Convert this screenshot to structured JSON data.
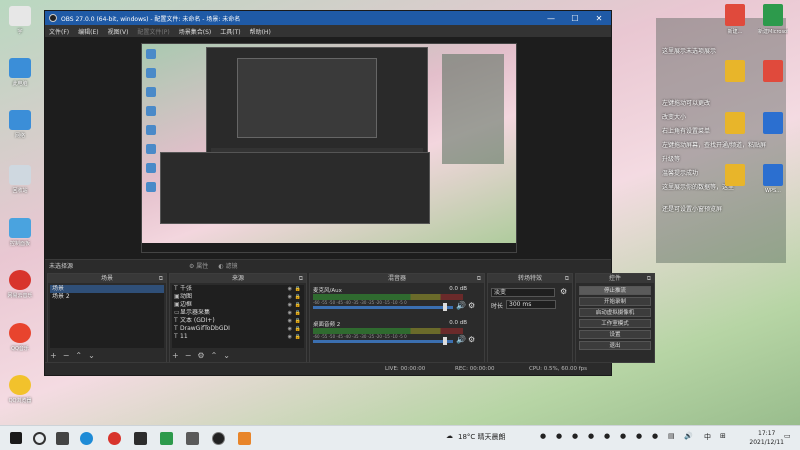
{
  "desktop": {
    "left_icons": [
      {
        "label": "宇",
        "color": "#e7e7e7"
      },
      {
        "label": "此电脑",
        "color": "#3b8ed8"
      },
      {
        "label": "网络",
        "color": "#3b8ed8"
      },
      {
        "label": "回收站",
        "color": "#cfd8e0"
      },
      {
        "label": "控制面板",
        "color": "#4aa3df"
      },
      {
        "label": "网易云音乐",
        "color": "#d8342c"
      },
      {
        "label": "QQ音乐",
        "color": "#e8442e"
      },
      {
        "label": "QQ浏览器",
        "color": "#f2c22c"
      }
    ],
    "right_icons": [
      {
        "label": "新建...",
        "color": "#e04a3c"
      },
      {
        "label": "新建Microsoft...",
        "color": "#2d9a4c"
      },
      {
        "label": "",
        "color": "#e8b52a"
      },
      {
        "label": "",
        "color": "#e04a3c"
      },
      {
        "label": "",
        "color": "#e8b52a"
      },
      {
        "label": "",
        "color": "#2b6fd0"
      },
      {
        "label": "",
        "color": "#e8b52a"
      },
      {
        "label": "WPS...",
        "color": "#2b6fd0"
      }
    ],
    "notes": [
      "这里展示未选项展示",
      "左键拖动可以更改",
      "改变大小",
      "右上角有设置菜单",
      "左键拖动屏幕，查找开通/频道，粘贴屏",
      "升级等",
      "温馨提示成功",
      "这里展示你的数据等，这里",
      "还是可设置小窗预览屏"
    ]
  },
  "obs": {
    "title": "OBS 27.0.0 (64-bit, windows) - 配置文件: 未命名 - 场景: 未命名",
    "window_buttons": [
      "—",
      "☐",
      "✕"
    ],
    "menu": [
      {
        "label": "文件(F)",
        "dim": false
      },
      {
        "label": "编辑(E)",
        "dim": false
      },
      {
        "label": "视图(V)",
        "dim": false
      },
      {
        "label": "配置文件(P)",
        "dim": true
      },
      {
        "label": "场景集合(S)",
        "dim": false
      },
      {
        "label": "工具(T)",
        "dim": false
      },
      {
        "label": "帮助(H)",
        "dim": false
      }
    ],
    "control_bar": {
      "no_source": "未选择源",
      "properties": "属性",
      "filters": "滤镜"
    },
    "scenes": {
      "header": "场景",
      "items": [
        "场景",
        "场景 2"
      ]
    },
    "sources": {
      "header": "来源",
      "items": [
        {
          "icon": "T",
          "label": "千张"
        },
        {
          "icon": "▣",
          "label": "动图"
        },
        {
          "icon": "▣",
          "label": "边框"
        },
        {
          "icon": "▭",
          "label": "显示器采集"
        },
        {
          "icon": "T",
          "label": "文本 (GDI+)"
        },
        {
          "icon": "T",
          "label": "DrawGifToDbGDI"
        },
        {
          "icon": "T",
          "label": "11"
        }
      ]
    },
    "mixer": {
      "header": "混音器",
      "tracks": [
        {
          "name": "麦克风/Aux",
          "db": "0.0 dB"
        },
        {
          "name": "桌面音频 2",
          "db": "0.0 dB"
        }
      ],
      "ticks": "-60 -55 -50 -45 -40 -35 -30 -25 -20 -15 -10 -5 0"
    },
    "transitions": {
      "header": "转场特效",
      "type": "淡变",
      "duration_label": "时长",
      "duration_value": "300 ms"
    },
    "controls": {
      "header": "控件",
      "buttons": [
        {
          "label": "停止推流",
          "active": true
        },
        {
          "label": "开始录制",
          "active": false
        },
        {
          "label": "启动虚拟摄像机",
          "active": false
        },
        {
          "label": "工作室模式",
          "active": false
        },
        {
          "label": "设置",
          "active": false
        },
        {
          "label": "退出",
          "active": false
        }
      ]
    },
    "status": {
      "live": "LIVE: 00:00:00",
      "rec": "REC: 00:00:00",
      "cpu": "CPU: 0.5%, 60.00 fps"
    }
  },
  "taskbar": {
    "weather": "18°C 晴天晨朗",
    "ime": "中",
    "time": "17:17",
    "date": "2021/12/11"
  }
}
